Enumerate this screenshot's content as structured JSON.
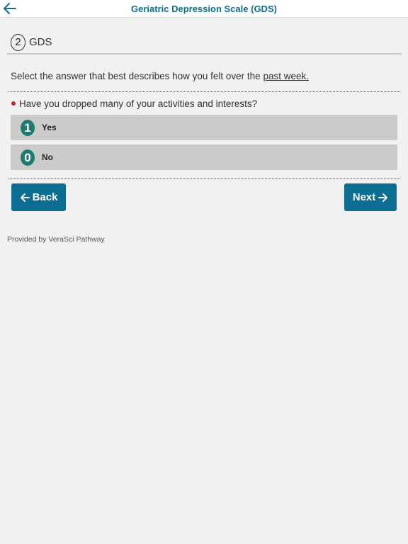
{
  "header": {
    "title": "Geriatric Depression Scale (GDS)",
    "back_icon": "arrow-left-icon"
  },
  "section": {
    "step_number": "2",
    "label": "GDS"
  },
  "instructions": {
    "text_before": "Select the answer that best describes how you felt over the ",
    "text_emphasis": "past week."
  },
  "question": {
    "text": "Have you dropped many of your activities and interests?",
    "required_color": "#c0282e"
  },
  "options": [
    {
      "score": "1",
      "label": "Yes"
    },
    {
      "score": "0",
      "label": "No"
    }
  ],
  "navigation": {
    "back_label": "Back",
    "next_label": "Next"
  },
  "footer": {
    "text": "Provided by VeraSci Pathway"
  },
  "colors": {
    "accent": "#0b6d92",
    "title": "#0f6e8f",
    "score_badge": "#1f7a6f"
  }
}
